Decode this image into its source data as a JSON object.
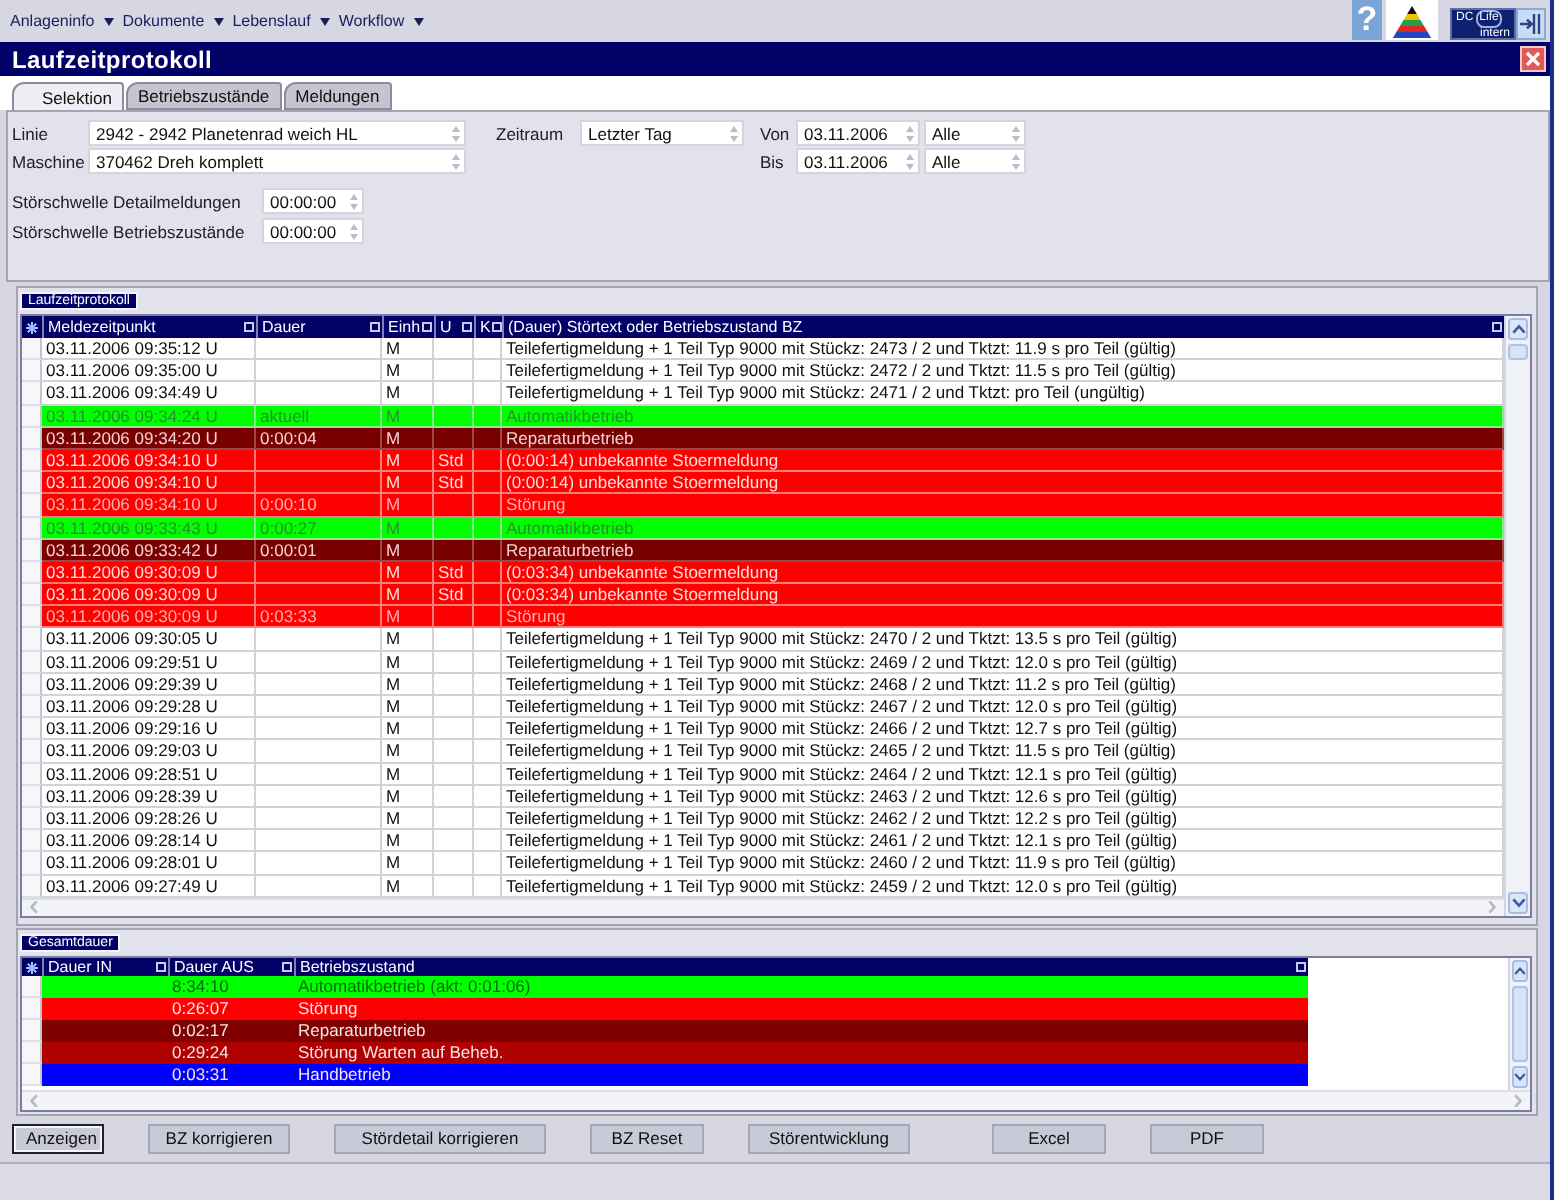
{
  "menu": [
    {
      "label": "Anlageninfo"
    },
    {
      "label": "Dokumente"
    },
    {
      "label": "Lebenslauf"
    },
    {
      "label": "Workflow"
    }
  ],
  "toolbar": {
    "help": "?",
    "logo": {
      "name": "DC",
      "product": "Life",
      "edition": "intern"
    }
  },
  "window": {
    "title": "Laufzeitprotokoll"
  },
  "tabs": [
    {
      "label": "Selektion",
      "selected": true
    },
    {
      "label": "Betriebszustände",
      "selected": false
    },
    {
      "label": "Meldungen",
      "selected": false
    }
  ],
  "selection": {
    "linie": {
      "label": "Linie",
      "value": "2942 - 2942 Planetenrad weich HL"
    },
    "maschine": {
      "label": "Maschine",
      "value": "370462 Dreh komplett"
    },
    "zeitraum": {
      "label": "Zeitraum",
      "value": "Letzter Tag"
    },
    "von": {
      "label": "Von",
      "date": "03.11.2006",
      "option": "Alle"
    },
    "bis": {
      "label": "Bis",
      "date": "03.11.2006",
      "option": "Alle"
    },
    "thresholds": [
      {
        "label": "Störschwelle Detailmeldungen",
        "value": "00:00:00"
      },
      {
        "label": "Störschwelle Betriebszustände",
        "value": "00:00:00"
      }
    ]
  },
  "log": {
    "title": "Laufzeitprotokoll",
    "columns": [
      "Meldezeitpunkt",
      "Dauer",
      "Einh",
      "U",
      "K",
      "(Dauer) Störtext oder Betriebszustand BZ"
    ],
    "rows": [
      {
        "kind": "message",
        "time": "03.11.2006 09:35:12 U",
        "unit": "M",
        "text": "Teilefertigmeldung + 1 Teil Typ 9000 mit Stückz: 2473 / 2 und Tktzt: 11.9 s pro Teil (gültig)"
      },
      {
        "kind": "message",
        "time": "03.11.2006 09:35:00 U",
        "unit": "M",
        "text": "Teilefertigmeldung + 1 Teil Typ 9000 mit Stückz: 2472 / 2 und Tktzt: 11.5 s pro Teil (gültig)"
      },
      {
        "kind": "message",
        "time": "03.11.2006 09:34:49 U",
        "unit": "M",
        "text": "Teilefertigmeldung + 1 Teil Typ 9000 mit Stückz: 2471 / 2 und Tktzt: pro Teil (ungültig)"
      },
      {
        "kind": "automatic",
        "time": "03.11.2006 09:34:24 U",
        "duration": "aktuell",
        "unit": "M",
        "text": "Automatikbetrieb"
      },
      {
        "kind": "repair",
        "time": "03.11.2006 09:34:20 U",
        "duration": "0:00:04",
        "unit": "M",
        "text": "Reparaturbetrieb"
      },
      {
        "kind": "fault",
        "time": "03.11.2006 09:34:10 U",
        "unit": "M",
        "u": "Std",
        "text": "(0:00:14) unbekannte Stoermeldung"
      },
      {
        "kind": "fault",
        "time": "03.11.2006 09:34:10 U",
        "unit": "M",
        "u": "Std",
        "text": "(0:00:14) unbekannte Stoermeldung"
      },
      {
        "kind": "fault_total",
        "time": "03.11.2006 09:34:10 U",
        "duration": "0:00:10",
        "unit": "M",
        "text": "Störung"
      },
      {
        "kind": "automatic",
        "time": "03.11.2006 09:33:43 U",
        "duration": "0:00:27",
        "unit": "M",
        "text": "Automatikbetrieb"
      },
      {
        "kind": "repair",
        "time": "03.11.2006 09:33:42 U",
        "duration": "0:00:01",
        "unit": "M",
        "text": "Reparaturbetrieb"
      },
      {
        "kind": "fault",
        "time": "03.11.2006 09:30:09 U",
        "unit": "M",
        "u": "Std",
        "text": "(0:03:34) unbekannte Stoermeldung"
      },
      {
        "kind": "fault",
        "time": "03.11.2006 09:30:09 U",
        "unit": "M",
        "u": "Std",
        "text": "(0:03:34) unbekannte Stoermeldung"
      },
      {
        "kind": "fault_total",
        "time": "03.11.2006 09:30:09 U",
        "duration": "0:03:33",
        "unit": "M",
        "text": "Störung"
      },
      {
        "kind": "message",
        "time": "03.11.2006 09:30:05 U",
        "unit": "M",
        "text": "Teilefertigmeldung + 1 Teil Typ 9000 mit Stückz: 2470 / 2 und Tktzt: 13.5 s pro Teil (gültig)"
      },
      {
        "kind": "message",
        "time": "03.11.2006 09:29:51 U",
        "unit": "M",
        "text": "Teilefertigmeldung + 1 Teil Typ 9000 mit Stückz: 2469 / 2 und Tktzt: 12.0 s pro Teil (gültig)"
      },
      {
        "kind": "message",
        "time": "03.11.2006 09:29:39 U",
        "unit": "M",
        "text": "Teilefertigmeldung + 1 Teil Typ 9000 mit Stückz: 2468 / 2 und Tktzt: 11.2 s pro Teil (gültig)"
      },
      {
        "kind": "message",
        "time": "03.11.2006 09:29:28 U",
        "unit": "M",
        "text": "Teilefertigmeldung + 1 Teil Typ 9000 mit Stückz: 2467 / 2 und Tktzt: 12.0 s pro Teil (gültig)"
      },
      {
        "kind": "message",
        "time": "03.11.2006 09:29:16 U",
        "unit": "M",
        "text": "Teilefertigmeldung + 1 Teil Typ 9000 mit Stückz: 2466 / 2 und Tktzt: 12.7 s pro Teil (gültig)"
      },
      {
        "kind": "message",
        "time": "03.11.2006 09:29:03 U",
        "unit": "M",
        "text": "Teilefertigmeldung + 1 Teil Typ 9000 mit Stückz: 2465 / 2 und Tktzt: 11.5 s pro Teil (gültig)"
      },
      {
        "kind": "message",
        "time": "03.11.2006 09:28:51 U",
        "unit": "M",
        "text": "Teilefertigmeldung + 1 Teil Typ 9000 mit Stückz: 2464 / 2 und Tktzt: 12.1 s pro Teil (gültig)"
      },
      {
        "kind": "message",
        "time": "03.11.2006 09:28:39 U",
        "unit": "M",
        "text": "Teilefertigmeldung + 1 Teil Typ 9000 mit Stückz: 2463 / 2 und Tktzt: 12.6 s pro Teil (gültig)"
      },
      {
        "kind": "message",
        "time": "03.11.2006 09:28:26 U",
        "unit": "M",
        "text": "Teilefertigmeldung + 1 Teil Typ 9000 mit Stückz: 2462 / 2 und Tktzt: 12.2 s pro Teil (gültig)"
      },
      {
        "kind": "message",
        "time": "03.11.2006 09:28:14 U",
        "unit": "M",
        "text": "Teilefertigmeldung + 1 Teil Typ 9000 mit Stückz: 2461 / 2 und Tktzt: 12.1 s pro Teil (gültig)"
      },
      {
        "kind": "message",
        "time": "03.11.2006 09:28:01 U",
        "unit": "M",
        "text": "Teilefertigmeldung + 1 Teil Typ 9000 mit Stückz: 2460 / 2 und Tktzt: 11.9 s pro Teil (gültig)"
      },
      {
        "kind": "message",
        "time": "03.11.2006 09:27:49 U",
        "unit": "M",
        "text": "Teilefertigmeldung + 1 Teil Typ 9000 mit Stückz: 2459 / 2 und Tktzt: 12.0 s pro Teil (gültig)"
      }
    ]
  },
  "summary": {
    "title": "Gesamtdauer",
    "columns": [
      "Dauer IN",
      "Dauer AUS",
      "Betriebszustand"
    ],
    "rows": [
      {
        "color": "#00ff00",
        "dauer_aus": "8:34:10",
        "zustand": "Automatikbetrieb (akt: 0:01:06)"
      },
      {
        "color": "#ff0000",
        "dauer_aus": "0:26:07",
        "zustand": "Störung"
      },
      {
        "color": "#800000",
        "dauer_aus": "0:02:17",
        "zustand": "Reparaturbetrieb"
      },
      {
        "color": "#b00000",
        "dauer_aus": "0:29:24",
        "zustand": "Störung Warten auf Beheb."
      },
      {
        "color": "#0000ff",
        "dauer_aus": "0:03:31",
        "zustand": "Handbetrieb"
      }
    ]
  },
  "buttons": [
    {
      "label": "Anzeigen",
      "focused": true
    },
    {
      "label": "BZ korrigieren",
      "focused": false
    },
    {
      "label": "Stördetail korrigieren",
      "focused": false
    },
    {
      "label": "BZ Reset",
      "focused": false
    },
    {
      "label": "Störentwicklung",
      "focused": false
    },
    {
      "label": "Excel",
      "focused": false
    },
    {
      "label": "PDF",
      "focused": false
    }
  ]
}
